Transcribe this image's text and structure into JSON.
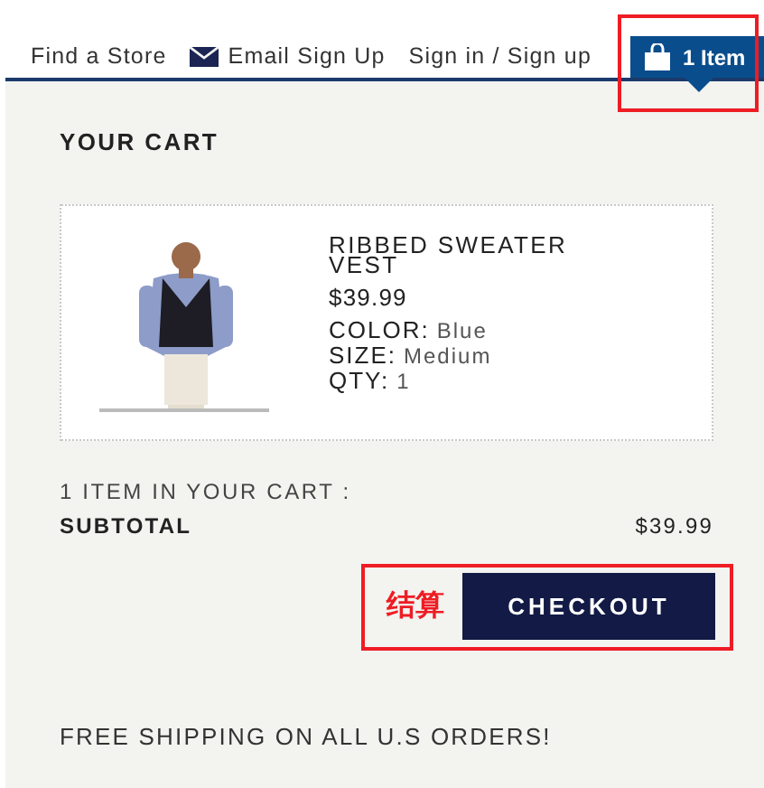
{
  "nav": {
    "links": [
      {
        "label": "Find a Store",
        "kind": "plain"
      },
      {
        "label": "Email Sign Up",
        "kind": "email"
      },
      {
        "label": "Sign in / Sign up",
        "kind": "plain"
      }
    ],
    "cart_button": {
      "label": "1 Item",
      "highlighted": true
    }
  },
  "cart": {
    "title": "YOUR CART",
    "items": [
      {
        "kind": "picture",
        "name": "RIBBED SWEATER VEST",
        "price": "$39.99",
        "attributes": [
          {
            "label": "COLOR:",
            "value": "Blue"
          },
          {
            "label": "SIZE:",
            "value": "Medium"
          },
          {
            "label": "QTY:",
            "value": "1"
          }
        ]
      }
    ],
    "count_text": "1 ITEM IN YOUR CART :",
    "subtotal_label": "SUBTOTAL",
    "subtotal_value": "$39.99",
    "checkout": {
      "label": "CHECKOUT",
      "note": "结算",
      "highlighted": true
    },
    "shipping_note": "FREE SHIPPING ON ALL U.S ORDERS!"
  }
}
